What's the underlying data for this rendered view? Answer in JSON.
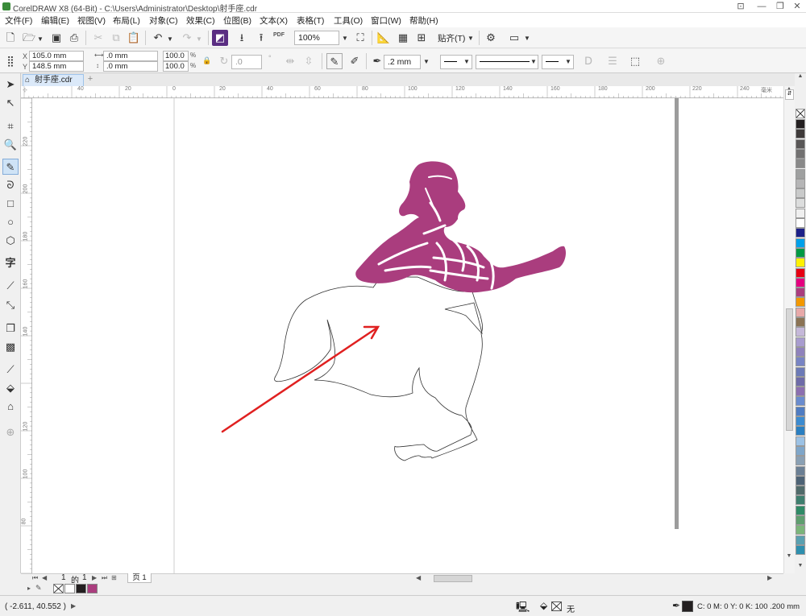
{
  "window": {
    "title": "CorelDRAW X8 (64-Bit) - C:\\Users\\Administrator\\Desktop\\射手座.cdr",
    "min": "—",
    "restore": "❐",
    "close": "✕",
    "help": "⊡"
  },
  "menu": [
    "文件(F)",
    "编辑(E)",
    "视图(V)",
    "布局(L)",
    "对象(C)",
    "效果(C)",
    "位图(B)",
    "文本(X)",
    "表格(T)",
    "工具(O)",
    "窗口(W)",
    "帮助(H)"
  ],
  "toolbar": {
    "zoom": "100%",
    "pdf": "PDF",
    "snap_label": "贴齐(T)"
  },
  "property_bar": {
    "x": "105.0 mm",
    "y": "148.5 mm",
    "w": ".0 mm",
    "h": ".0 mm",
    "sx": "100.0",
    "sy": "100.0",
    "pct": "%",
    "angle": ".0",
    "outline_width": ".2 mm"
  },
  "doc_tab": {
    "label": "射手座.cdr",
    "add": "+"
  },
  "ruler": {
    "h_labels": [
      "40",
      "20",
      "0",
      "20",
      "40",
      "60",
      "80",
      "100",
      "120",
      "140",
      "160",
      "180",
      "200",
      "220",
      "240"
    ],
    "unit": "毫米",
    "v_labels": [
      "220",
      "200",
      "180",
      "160",
      "140",
      "120",
      "100",
      "80"
    ]
  },
  "page_nav": {
    "current": "1",
    "sep": "的",
    "total": "1",
    "page_tab": "页 1"
  },
  "status": {
    "coords": "( -2.611, 40.552 )",
    "fill_none": "无",
    "color_info": "C: 0 M: 0 Y: 0 K: 100  .200 mm"
  },
  "colors": {
    "figure": "#aa3d7e",
    "arrow": "#e02020",
    "palette": [
      "#231f20",
      "#3e3a39",
      "#595757",
      "#727171",
      "#898989",
      "#9fa0a0",
      "#b5b5b6",
      "#c9caca",
      "#dcdddd",
      "#efefef",
      "#ffffff",
      "#1d2088",
      "#00a0e9",
      "#009944",
      "#fff100",
      "#e60012",
      "#e4007f",
      "#aa3d7e",
      "#f39800",
      "#e8a9a9",
      "#8b7355",
      "#c5b8d9",
      "#a89ccf",
      "#8f82bc",
      "#7884c4",
      "#6c7ab7",
      "#6e6ba8",
      "#8c6fb0",
      "#6a8ccf",
      "#4f7cc2",
      "#3c8bd0",
      "#2a7fc1",
      "#9cc2e5",
      "#7fa6c9",
      "#8aa0b4",
      "#6b7f94",
      "#4d6275",
      "#506a6a",
      "#3e7e6e",
      "#2f8a66",
      "#5e9e6f",
      "#7bb57a",
      "#5aa0b0",
      "#2e8fae"
    ]
  }
}
